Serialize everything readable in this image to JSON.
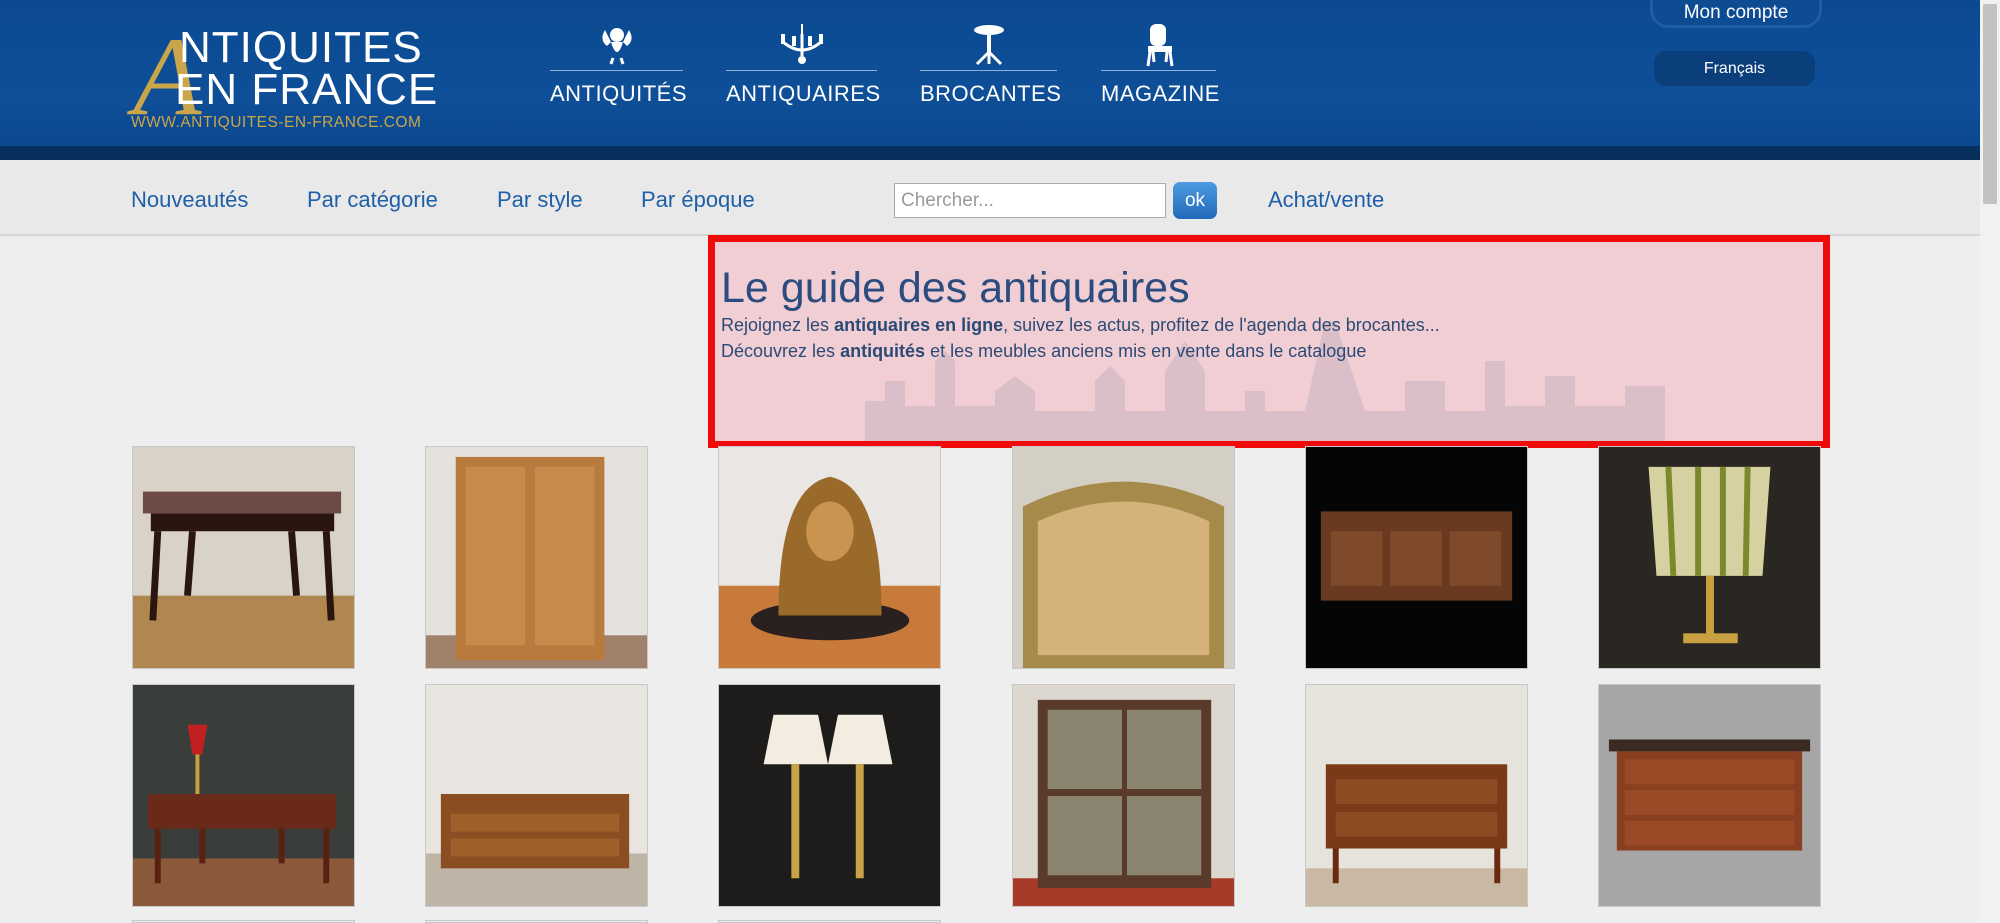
{
  "header": {
    "logo": {
      "letter": "A",
      "line1": "NTIQUITES",
      "line2": "EN FRANCE",
      "url": "WWW.ANTIQUITES-EN-FRANCE.COM"
    },
    "nav": [
      {
        "label": "ANTIQUITÉS",
        "icon": "cherub-icon"
      },
      {
        "label": "ANTIQUAIRES",
        "icon": "chandelier-icon"
      },
      {
        "label": "BROCANTES",
        "icon": "pedestal-table-icon"
      },
      {
        "label": "MAGAZINE",
        "icon": "chair-icon"
      }
    ],
    "account_label": "Mon compte",
    "language_label": "Français"
  },
  "subnav": {
    "links": [
      "Nouveautés",
      "Par catégorie",
      "Par style",
      "Par époque"
    ],
    "search_placeholder": "Chercher...",
    "search_button": "ok",
    "extra_link": "Achat/vente"
  },
  "guide": {
    "title": "Le guide des antiquaires",
    "line1_pre": "Rejoignez les ",
    "line1_bold": "antiquaires en ligne",
    "line1_post": ", suivez les actus, profitez de l'agenda des brocantes...",
    "line2_pre": "Découvrez les ",
    "line2_bold": "antiquités",
    "line2_post": " et les meubles anciens mis en vente dans le catalogue"
  },
  "products": [
    {
      "name": "marble-console-table"
    },
    {
      "name": "burl-wood-cabinet"
    },
    {
      "name": "bronze-madonna-bust"
    },
    {
      "name": "gilded-headboard"
    },
    {
      "name": "carved-sideboard"
    },
    {
      "name": "beaded-table-lamp"
    },
    {
      "name": "writing-desk"
    },
    {
      "name": "chest-of-drawers"
    },
    {
      "name": "pair-of-brass-lamps"
    },
    {
      "name": "mirrored-panel"
    },
    {
      "name": "walnut-commode"
    },
    {
      "name": "mahogany-commode"
    }
  ],
  "colors": {
    "header_blue": "#0d4b93",
    "gold": "#c9a64a",
    "link_blue": "#1f5fa8",
    "highlight_border": "#f00a0a"
  }
}
